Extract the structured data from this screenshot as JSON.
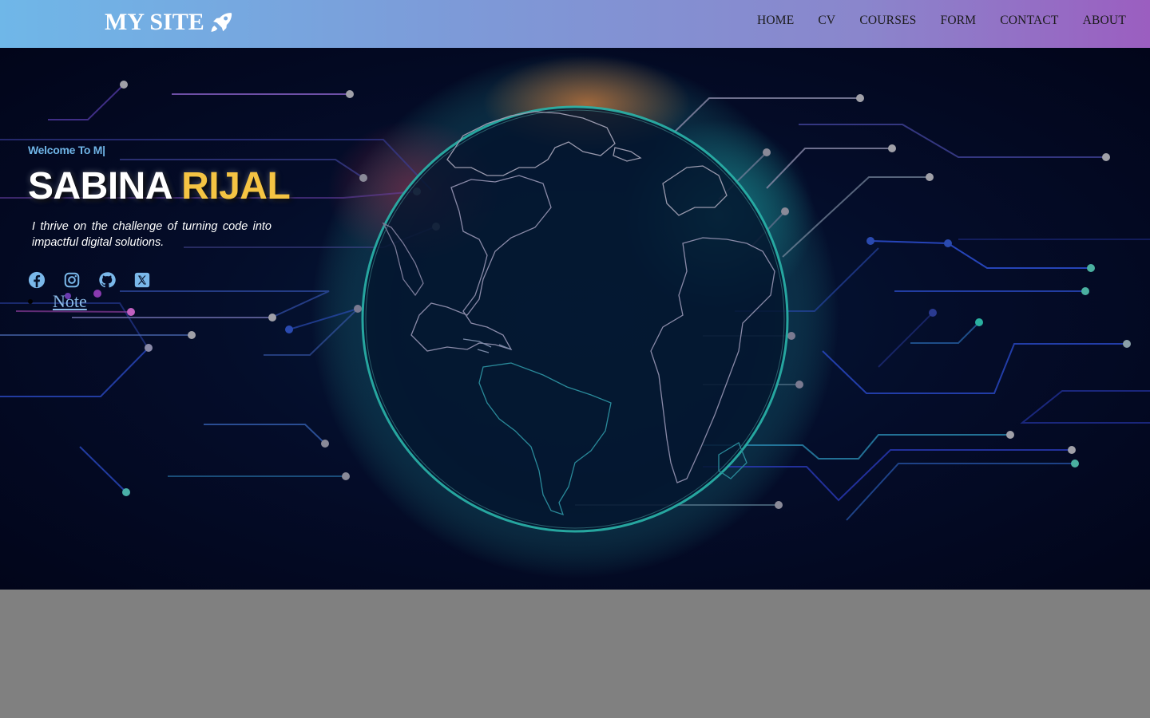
{
  "navbar": {
    "brand": "MY SITE",
    "brand_icon": "rocket-icon",
    "links": [
      "HOME",
      "CV",
      "COURSES",
      "FORM",
      "CONTACT",
      "ABOUT"
    ]
  },
  "hero": {
    "welcome": "Welcome To M|",
    "first_name": "SABINA",
    "last_name": "RIJAL",
    "tagline": "I thrive on the challenge of turning code into impactful digital solutions.",
    "socials": [
      "facebook-icon",
      "instagram-icon",
      "github-icon",
      "x-twitter-icon"
    ],
    "note_link": "Note",
    "colors": {
      "accent": "#6fb4e6",
      "last_name": "#f5c443",
      "globe": "#2ec4b6"
    }
  }
}
